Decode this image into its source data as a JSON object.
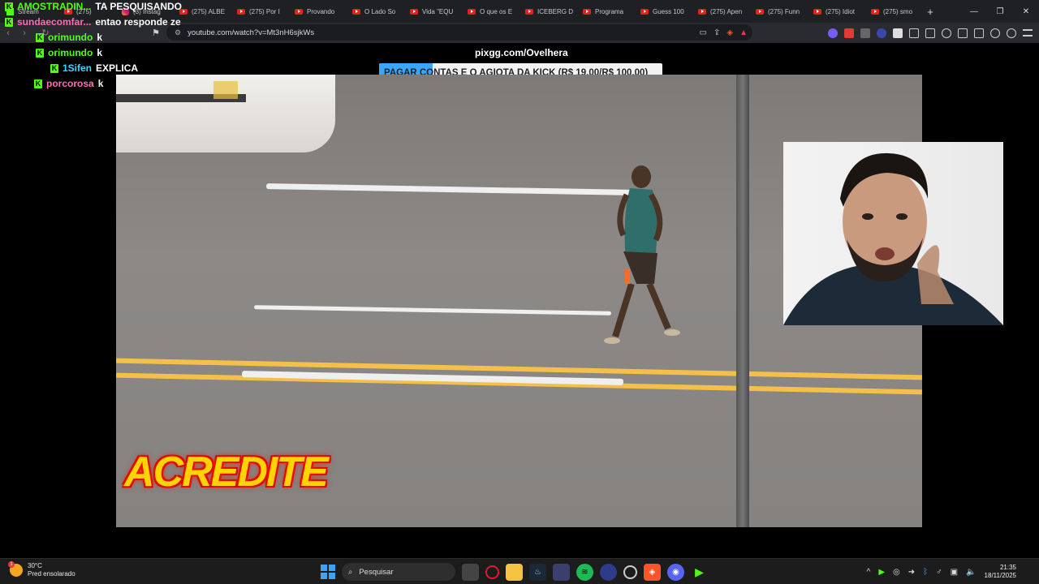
{
  "browser": {
    "tabs": [
      {
        "label": "Stream",
        "icon": "kick-icon"
      },
      {
        "label": "(275)",
        "icon": "youtube-icon"
      },
      {
        "label": "(3) Instag",
        "icon": "instagram-icon"
      },
      {
        "label": "(275) ALBE",
        "icon": "youtube-icon"
      },
      {
        "label": "(275) Por I",
        "icon": "youtube-icon"
      },
      {
        "label": "Provando",
        "icon": "youtube-icon"
      },
      {
        "label": "O Lado So",
        "icon": "youtube-icon"
      },
      {
        "label": "Vida \"EQU",
        "icon": "youtube-icon"
      },
      {
        "label": "O que os E",
        "icon": "youtube-icon"
      },
      {
        "label": "ICEBERG D",
        "icon": "youtube-icon"
      },
      {
        "label": "Programa",
        "icon": "youtube-icon"
      },
      {
        "label": "Guess 100",
        "icon": "youtube-icon"
      },
      {
        "label": "(275) Apen",
        "icon": "youtube-icon"
      },
      {
        "label": "(275) Funn",
        "icon": "youtube-icon"
      },
      {
        "label": "(275) Idiot",
        "icon": "youtube-icon"
      },
      {
        "label": "(275) smo",
        "icon": "youtube-icon"
      }
    ],
    "new_tab": "+",
    "url": "youtube.com/watch?v=Mt3nH6sjkWs"
  },
  "stream": {
    "pix_url": "pixgg.com/Ovelhera",
    "donation_goal": {
      "text": "PAGAR CONTAS E O AGIOTA DA KICK (R$ 19,00/R$ 100,00)",
      "current": 19.0,
      "target": 100.0,
      "fill_color": "#3aa6ff"
    },
    "video_caption": "ACREDITE"
  },
  "chat": [
    {
      "user": "AMOSTRADIN...",
      "text": "TA PESQUISANDO",
      "color": "#53fc18"
    },
    {
      "user": "sundaecomfar...",
      "text": "entao responde ze",
      "color": "#ff6bb5"
    },
    {
      "user": "orimundo",
      "text": "k",
      "color": "#53fc18"
    },
    {
      "user": "orimundo",
      "text": "k",
      "color": "#53fc18"
    },
    {
      "user": "1Sifen",
      "text": "EXPLICA",
      "color": "#3fd6ff"
    },
    {
      "user": "porcorosa",
      "text": "k",
      "color": "#ff6bb5"
    }
  ],
  "taskbar": {
    "weather_temp": "30°C",
    "weather_desc": "Pred ensolarado",
    "search_placeholder": "Pesquisar",
    "time": "21:35",
    "date": "18/11/2025",
    "notification_badge": "1"
  }
}
